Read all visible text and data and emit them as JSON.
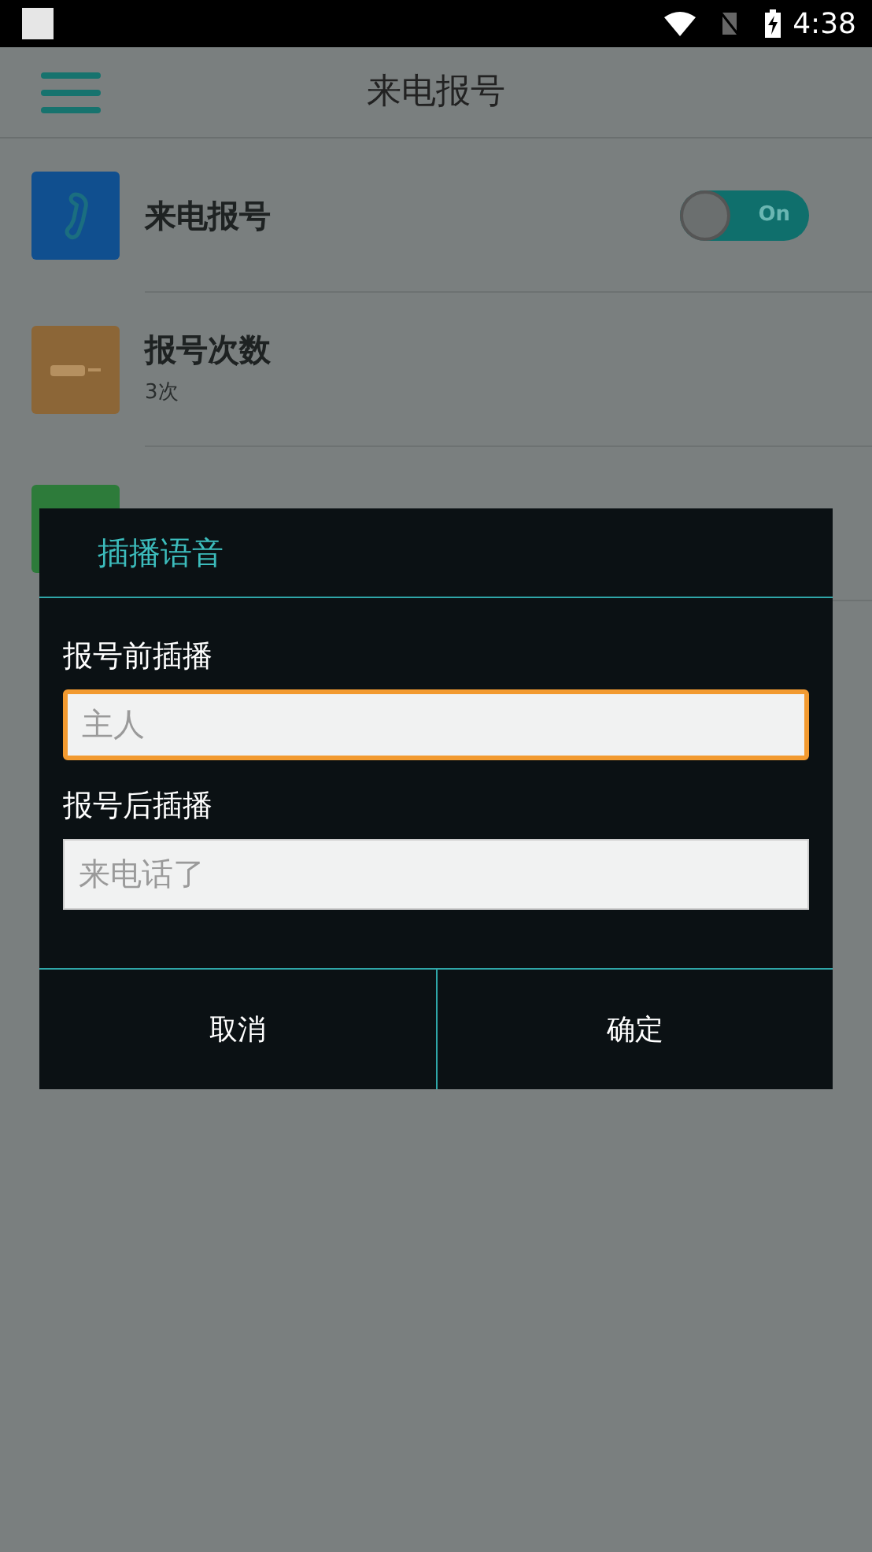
{
  "status_bar": {
    "time": "4:38"
  },
  "app_bar": {
    "title": "来电报号"
  },
  "settings": [
    {
      "kind": "toggle",
      "title": "来电报号",
      "toggle": {
        "on": true,
        "label": "On"
      }
    },
    {
      "kind": "value",
      "title": "报号次数",
      "subtitle": "3次"
    },
    {
      "kind": "plain"
    }
  ],
  "dialog": {
    "title": "插播语音",
    "fields": [
      {
        "label": "报号前插播",
        "placeholder": "主人",
        "focused": true
      },
      {
        "label": "报号后插播",
        "placeholder": "来电话了",
        "focused": false
      }
    ],
    "buttons": [
      "取消",
      "确定"
    ]
  }
}
